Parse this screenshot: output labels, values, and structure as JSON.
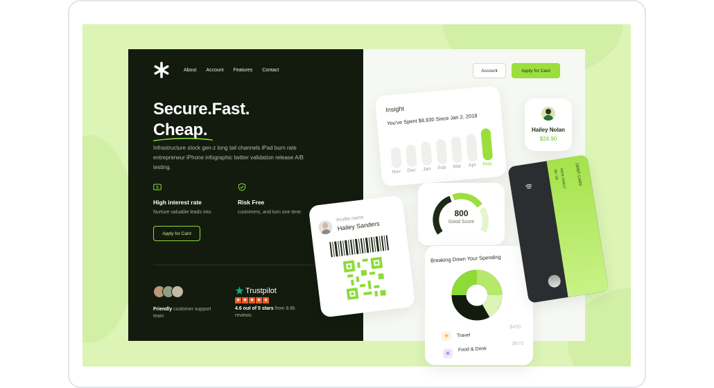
{
  "nav": {
    "items": [
      "About",
      "Account",
      "Features",
      "Contact"
    ]
  },
  "hero": {
    "line1": "Secure.Fast.",
    "line2": "Cheap.",
    "lead": "Infrastructure stock gen-z long tail channels iPad burn rate entrepreneur iPhone infographic twitter validation release A/B testing."
  },
  "features": [
    {
      "title": "High interest rate",
      "subtitle": "Nurture valuable leads into.",
      "icon": "money-icon"
    },
    {
      "title": "Risk Free",
      "subtitle": "customers, and turn one time.",
      "icon": "shield-check-icon"
    }
  ],
  "cta": {
    "label": "Apply for Card"
  },
  "support": {
    "strong": "Friendly",
    "rest": " customer support team"
  },
  "trustpilot": {
    "brand": "Trustpilot",
    "stars": 5,
    "rating_strong": "4.6 out of 5 stars",
    "rating_rest": " from 8.6k reviews",
    "accent": "#00b67a"
  },
  "header": {
    "account": "Account",
    "apply": "Apply for Card"
  },
  "insight": {
    "title": "Insight",
    "subtitle": "You've Spent $8,930 Since Jan 2, 2018",
    "months": [
      "Nov",
      "Dec",
      "Jan",
      "Feb",
      "Mar",
      "Apr",
      "May"
    ]
  },
  "profile_card": {
    "name": "Hailey Nolan",
    "amount": "$24.90"
  },
  "qr_card": {
    "label": "Profile name",
    "name": "Hailey Sanders"
  },
  "score": {
    "value": "800",
    "label": "Good Score"
  },
  "spending": {
    "title": "Breaking Down Your Spending",
    "items": [
      {
        "label": "Travel",
        "amount": "$450",
        "icon": "plane-icon",
        "color": "#f39a1f"
      },
      {
        "label": "Food & Drink",
        "amount": "$670",
        "icon": "cutlery-icon",
        "color": "#7c52d6"
      }
    ]
  },
  "debit": {
    "label": "DEBIT CARD",
    "name": "NICK OAKLY",
    "expiry": "05 / 26"
  },
  "colors": {
    "accent": "#9bde3e",
    "dark": "#131b0f",
    "background": "#dcf5b6"
  }
}
